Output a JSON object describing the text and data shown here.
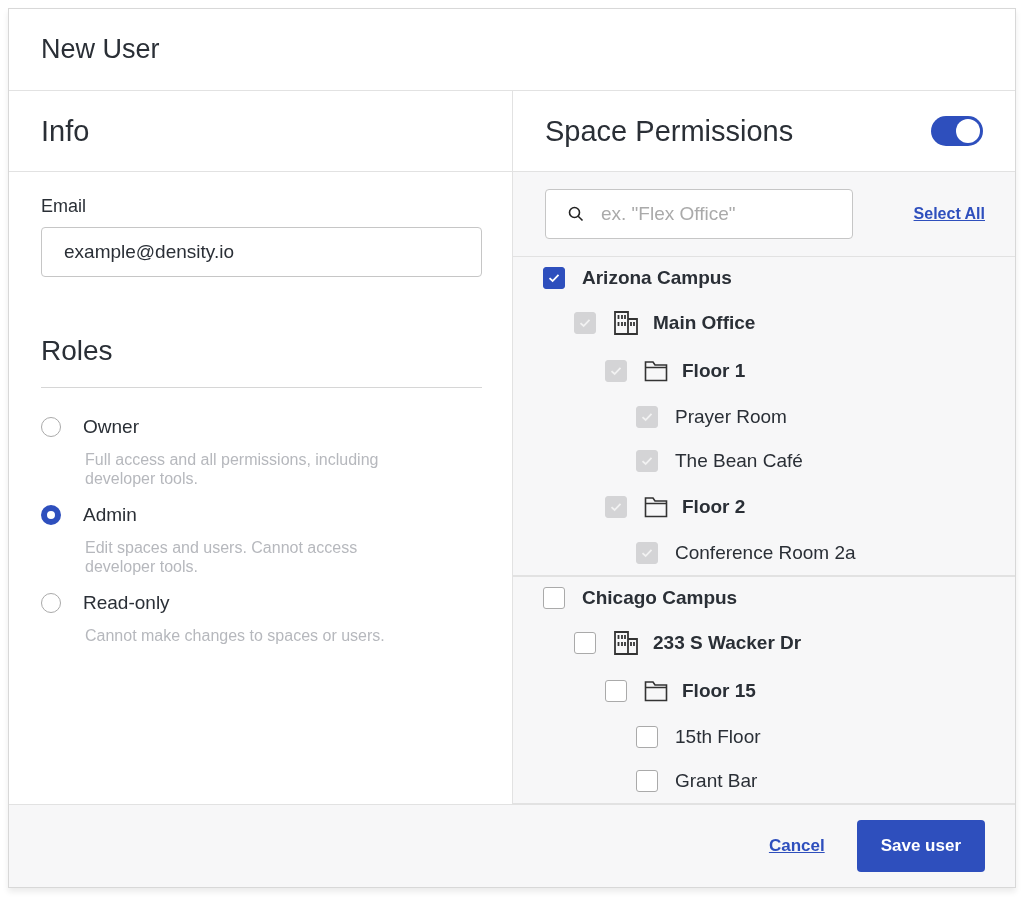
{
  "dialog": {
    "title": "New User"
  },
  "info": {
    "heading": "Info",
    "email_label": "Email",
    "email_value": "example@density.io"
  },
  "roles": {
    "heading": "Roles",
    "options": [
      {
        "label": "Owner",
        "description": "Full access and all permissions, including developer tools.",
        "selected": false
      },
      {
        "label": "Admin",
        "description": "Edit spaces and users. Cannot access developer tools.",
        "selected": true
      },
      {
        "label": "Read-only",
        "description": "Cannot make changes to spaces or users.",
        "selected": false
      }
    ]
  },
  "space_permissions": {
    "heading": "Space Permissions",
    "on": true,
    "search": {
      "placeholder": "ex. \"Flex Office\""
    },
    "select_all": "Select All",
    "tree": [
      {
        "kind": "campus",
        "label": "Arizona Campus",
        "checked": true,
        "disabled": false,
        "children": [
          {
            "kind": "building",
            "label": "Main Office",
            "checked": true,
            "disabled": true,
            "children": [
              {
                "kind": "floor",
                "label": "Floor 1",
                "checked": true,
                "disabled": true,
                "children": [
                  {
                    "kind": "space",
                    "label": "Prayer Room",
                    "checked": true,
                    "disabled": true
                  },
                  {
                    "kind": "space",
                    "label": "The Bean Café",
                    "checked": true,
                    "disabled": true
                  }
                ]
              },
              {
                "kind": "floor",
                "label": "Floor 2",
                "checked": true,
                "disabled": true,
                "children": [
                  {
                    "kind": "space",
                    "label": "Conference Room 2a",
                    "checked": true,
                    "disabled": true
                  }
                ]
              }
            ]
          }
        ]
      },
      {
        "kind": "campus",
        "label": "Chicago Campus",
        "checked": false,
        "disabled": false,
        "children": [
          {
            "kind": "building",
            "label": "233 S Wacker Dr",
            "checked": false,
            "disabled": false,
            "children": [
              {
                "kind": "floor",
                "label": "Floor 15",
                "checked": false,
                "disabled": false,
                "children": [
                  {
                    "kind": "space",
                    "label": "15th Floor",
                    "checked": false,
                    "disabled": false
                  },
                  {
                    "kind": "space",
                    "label": "Grant Bar",
                    "checked": false,
                    "disabled": false
                  }
                ]
              }
            ]
          }
        ]
      }
    ]
  },
  "footer": {
    "cancel": "Cancel",
    "save": "Save user"
  }
}
